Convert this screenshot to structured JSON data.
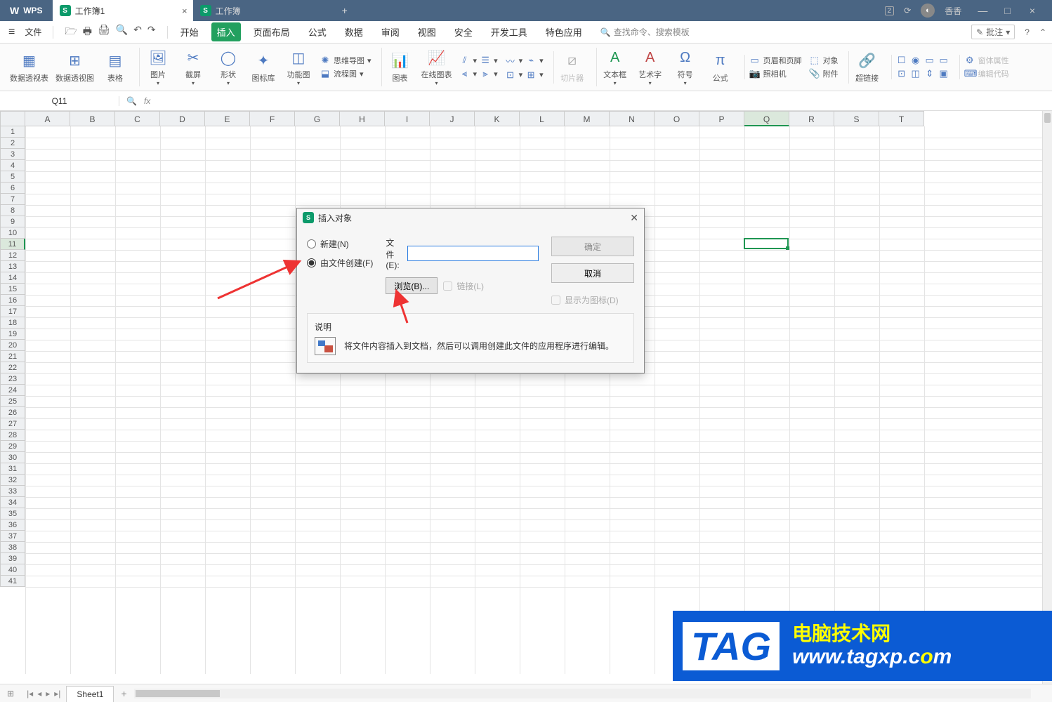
{
  "titlebar": {
    "appname": "WPS",
    "tabs": [
      {
        "label": "工作簿1",
        "active": true
      },
      {
        "label": "工作簿",
        "active": false
      }
    ],
    "badge": "2",
    "user": "香香"
  },
  "menubar": {
    "file": "文件",
    "tabs": [
      "开始",
      "插入",
      "页面布局",
      "公式",
      "数据",
      "审阅",
      "视图",
      "安全",
      "开发工具",
      "特色应用"
    ],
    "active_tab": "插入",
    "search_placeholder": "查找命令、搜索模板",
    "annotate": "批注"
  },
  "ribbon": {
    "pivottable": "数据透视表",
    "pivotchart": "数据透视图",
    "table": "表格",
    "pictures": "图片",
    "screenshot": "截屏",
    "shapes": "形状",
    "iconlib": "图标库",
    "smartart": "功能图",
    "mindmap": "思维导图",
    "flowchart": "流程图",
    "chart": "图表",
    "onlinechart": "在线图表",
    "slicer": "切片器",
    "textbox": "文本框",
    "wordart": "艺术字",
    "symbol": "符号",
    "equation": "公式",
    "headerfooter": "页眉和页脚",
    "camera": "照相机",
    "object": "对象",
    "attachment": "附件",
    "hyperlink": "超链接",
    "form_props": "窗体属性",
    "edit_code": "编辑代码"
  },
  "namebox": "Q11",
  "columns": [
    "A",
    "B",
    "C",
    "D",
    "E",
    "F",
    "G",
    "H",
    "I",
    "J",
    "K",
    "L",
    "M",
    "N",
    "O",
    "P",
    "Q",
    "R",
    "S",
    "T"
  ],
  "active_col": "Q",
  "active_row": 11,
  "row_count": 41,
  "sheet": {
    "name": "Sheet1"
  },
  "dialog": {
    "title": "插入对象",
    "create_new": "新建(N)",
    "from_file": "由文件创建(F)",
    "file_label": "文件(E):",
    "browse": "浏览(B)...",
    "link": "链接(L)",
    "as_icon": "显示为图标(D)",
    "ok": "确定",
    "cancel": "取消",
    "desc_title": "说明",
    "desc_text": "将文件内容插入到文档，然后可以调用创建此文件的应用程序进行编辑。"
  },
  "watermark": {
    "tag": "TAG",
    "line1": "电脑技术网",
    "line2_pre": "www.tagxp.c",
    "line2_o": "o",
    "line2_post": "m"
  }
}
